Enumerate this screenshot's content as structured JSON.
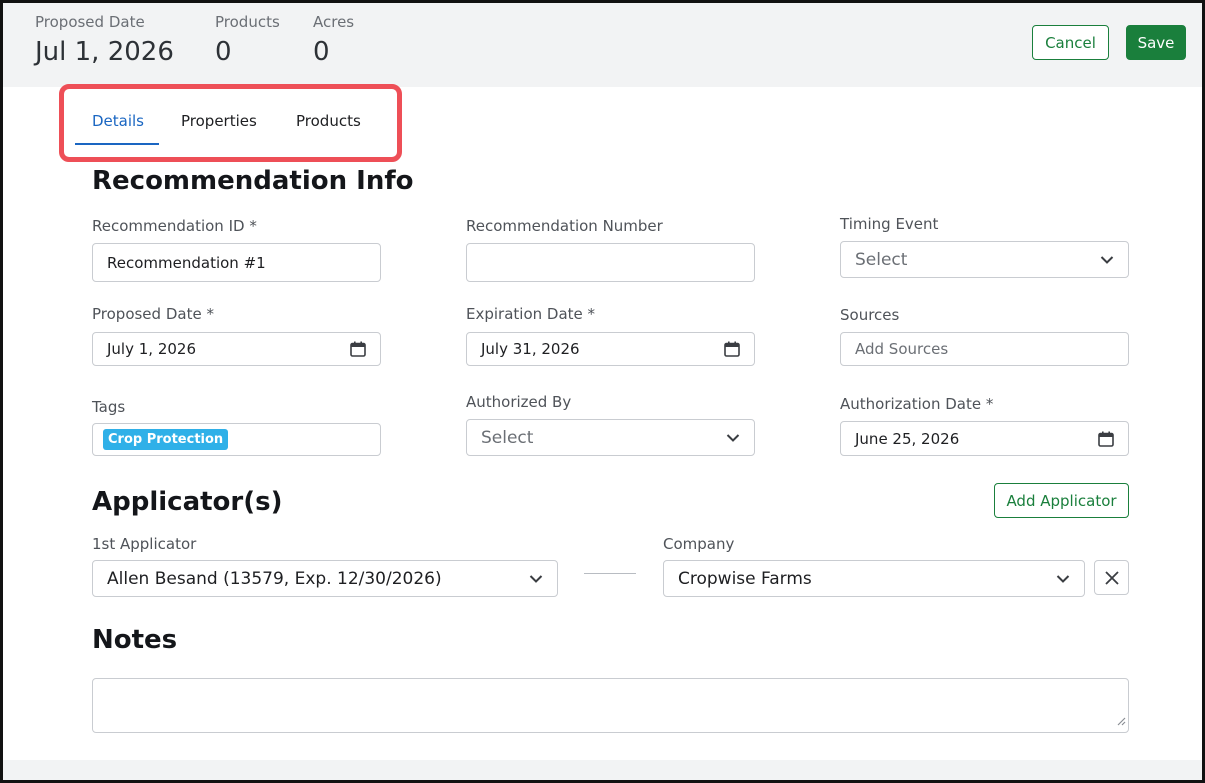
{
  "header": {
    "stats": [
      {
        "label": "Proposed Date",
        "value": "Jul 1, 2026"
      },
      {
        "label": "Products",
        "value": "0"
      },
      {
        "label": "Acres",
        "value": "0"
      }
    ],
    "cancel_label": "Cancel",
    "save_label": "Save"
  },
  "tabs": [
    {
      "label": "Details",
      "active": true
    },
    {
      "label": "Properties",
      "active": false
    },
    {
      "label": "Products",
      "active": false
    }
  ],
  "recommendation_info": {
    "title": "Recommendation Info",
    "recommendation_id": {
      "label": "Recommendation ID *",
      "value": "Recommendation #1"
    },
    "recommendation_number": {
      "label": "Recommendation Number",
      "value": ""
    },
    "timing_event": {
      "label": "Timing Event",
      "placeholder": "Select"
    },
    "proposed_date": {
      "label": "Proposed Date *",
      "value": "July 1,  2026"
    },
    "expiration_date": {
      "label": "Expiration Date *",
      "value": "July 31,  2026"
    },
    "sources": {
      "label": "Sources",
      "placeholder": "Add Sources"
    },
    "tags": {
      "label": "Tags",
      "items": [
        "Crop Protection"
      ]
    },
    "authorized_by": {
      "label": "Authorized By",
      "placeholder": "Select"
    },
    "authorization_date": {
      "label": "Authorization Date *",
      "value": "June 25,  2026"
    }
  },
  "applicators": {
    "title": "Applicator(s)",
    "add_label": "Add Applicator",
    "first_applicator": {
      "label": "1st Applicator",
      "value": "Allen Besand (13579, Exp. 12/30/2026)"
    },
    "company": {
      "label": "Company",
      "value": "Cropwise Farms"
    }
  },
  "notes": {
    "title": "Notes",
    "value": ""
  },
  "colors": {
    "accent_green": "#1a7f3c",
    "tab_blue": "#1a66c2",
    "highlight_red": "#ee4f57",
    "tag_blue": "#2fb0e8"
  }
}
